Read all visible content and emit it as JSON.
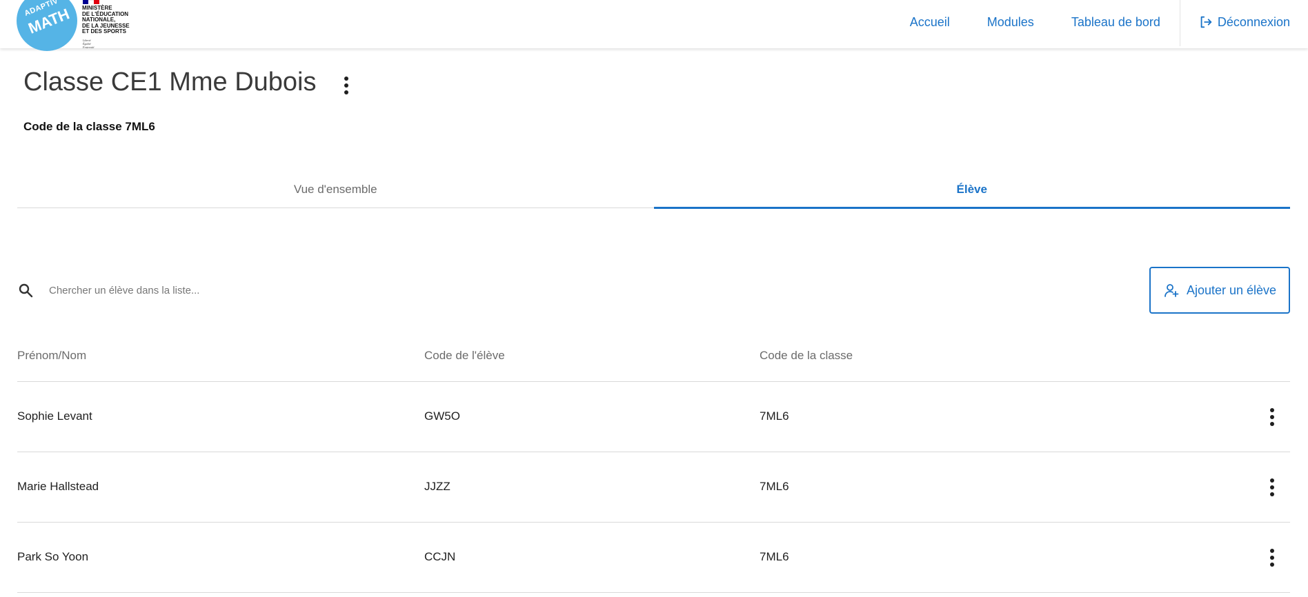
{
  "header": {
    "logo_top": "ADAPTIV'",
    "logo_main": "MATH",
    "ministry": "MINISTÈRE\nDE L'ÉDUCATION\nNATIONALE,\nDE LA JEUNESSE\nET DES SPORTS",
    "motto": "Liberté\nÉgalité\nFraternité",
    "nav": {
      "home": "Accueil",
      "modules": "Modules",
      "dashboard": "Tableau de bord",
      "logout": "Déconnexion"
    }
  },
  "page": {
    "title": "Classe CE1 Mme Dubois",
    "class_code_label": "Code de la classe",
    "class_code_value": "7ML6"
  },
  "tabs": [
    {
      "label": "Vue d'ensemble",
      "active": false
    },
    {
      "label": "Élève",
      "active": true
    }
  ],
  "search": {
    "placeholder": "Chercher un élève dans la liste..."
  },
  "add_button": {
    "label": "Ajouter un élève"
  },
  "table": {
    "headers": [
      "Prénom/Nom",
      "Code de l'élève",
      "Code de la classe"
    ],
    "rows": [
      {
        "name": "Sophie Levant",
        "student_code": "GW5O",
        "class_code": "7ML6"
      },
      {
        "name": "Marie Hallstead",
        "student_code": "JJZZ",
        "class_code": "7ML6"
      },
      {
        "name": "Park So Yoon",
        "student_code": "CCJN",
        "class_code": "7ML6"
      }
    ]
  },
  "colors": {
    "accent": "#1a73c8",
    "logo": "#55b4e6",
    "divider": "#d9d9d9",
    "flag_blue": "#000091",
    "flag_white": "#ffffff",
    "flag_red": "#e1000f"
  }
}
